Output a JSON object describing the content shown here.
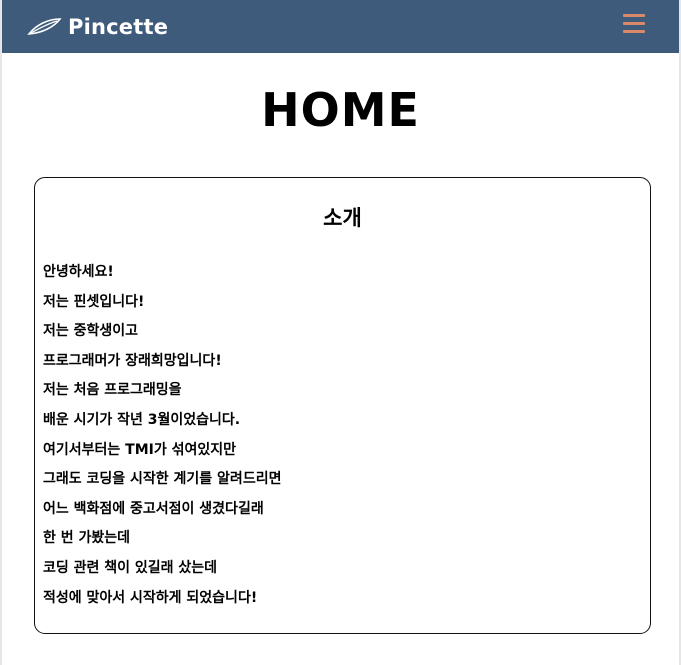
{
  "navbar": {
    "brand_name": "Pincette",
    "brand_icon": "feather-icon",
    "menu_icon": "hamburger-menu-icon",
    "background_color": "#3f5b7b",
    "menu_icon_color": "#d9896a"
  },
  "page": {
    "title": "HOME"
  },
  "intro_card": {
    "title": "소개",
    "lines": [
      "안녕하세요!",
      "저는 핀셋입니다!",
      "저는 중학생이고",
      "프로그래머가 장래희망입니다!",
      "저는 처음 프로그래밍을",
      "배운 시기가 작년 3월이었습니다.",
      "여기서부터는 TMI가 섞여있지만",
      "그래도 코딩을 시작한 계기를 알려드리면",
      "어느 백화점에 중고서점이 생겼다길래",
      "한 번 가봤는데",
      "코딩 관련 책이 있길래 샀는데",
      "적성에 맞아서 시작하게 되었습니다!"
    ]
  }
}
